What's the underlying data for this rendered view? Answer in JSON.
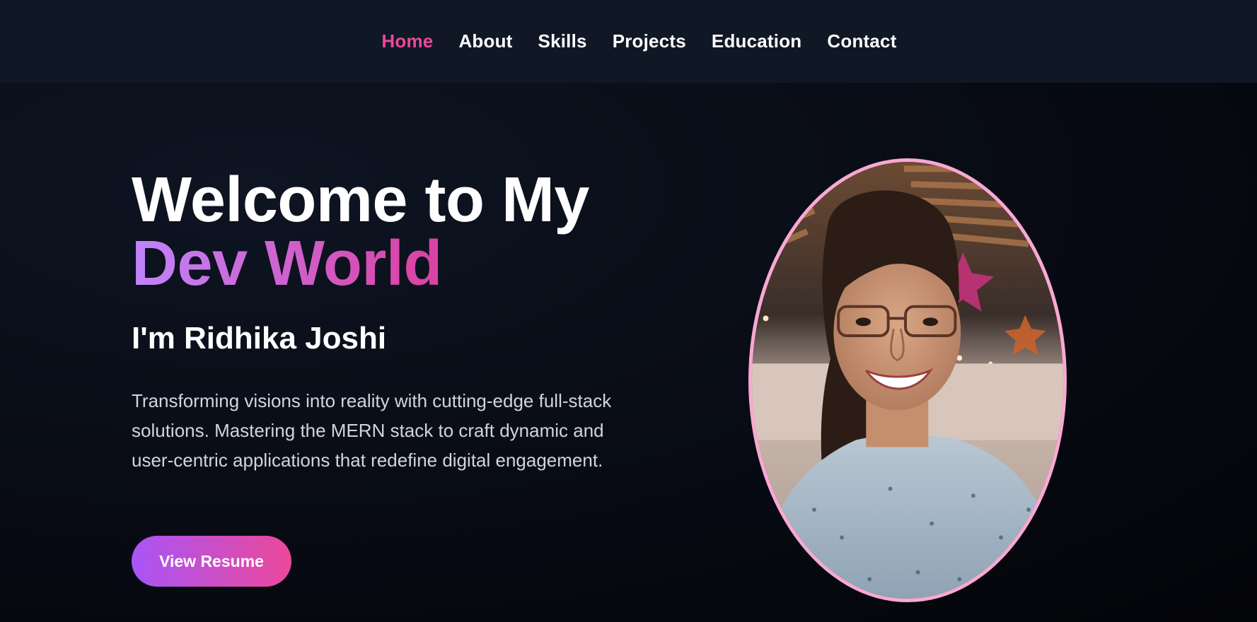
{
  "nav": {
    "items": [
      {
        "label": "Home",
        "active": true
      },
      {
        "label": "About",
        "active": false
      },
      {
        "label": "Skills",
        "active": false
      },
      {
        "label": "Projects",
        "active": false
      },
      {
        "label": "Education",
        "active": false
      },
      {
        "label": "Contact",
        "active": false
      }
    ]
  },
  "hero": {
    "headline_line1": "Welcome to My",
    "headline_line2": "Dev World",
    "subtitle": "I'm Ridhika Joshi",
    "description": "Transforming visions into reality with cutting-edge full-stack solutions. Mastering the MERN stack to craft dynamic and user-centric applications that redefine digital engagement.",
    "resume_button": "View Resume"
  },
  "photo": {
    "alt": "profile-photo"
  },
  "colors": {
    "accent_pink": "#ec4899",
    "accent_purple": "#a855f7",
    "frame_border": "#f9a8d4",
    "background": "#080b14",
    "nav_background": "#101725"
  }
}
